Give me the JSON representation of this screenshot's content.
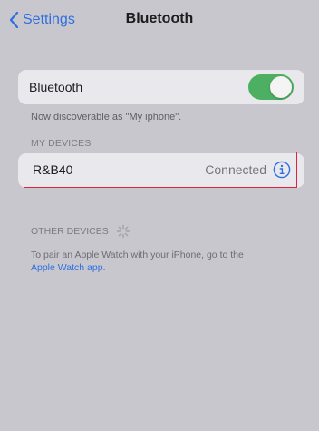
{
  "nav": {
    "back_label": "Settings",
    "title": "Bluetooth"
  },
  "bluetooth": {
    "label": "Bluetooth",
    "enabled": true,
    "toggle_color": "#4caf62",
    "discoverable_text": "Now discoverable as \"My iphone\"."
  },
  "my_devices": {
    "header": "MY DEVICES",
    "items": [
      {
        "name": "R&B40",
        "status": "Connected",
        "icon": "info-icon"
      }
    ]
  },
  "other_devices": {
    "header": "OTHER DEVICES",
    "note": "To pair an Apple Watch with your iPhone, go to the",
    "link": "Apple Watch app."
  },
  "colors": {
    "accent": "#2f6fe0",
    "highlight_border": "#d9263a",
    "background": "#c9c7ce"
  }
}
